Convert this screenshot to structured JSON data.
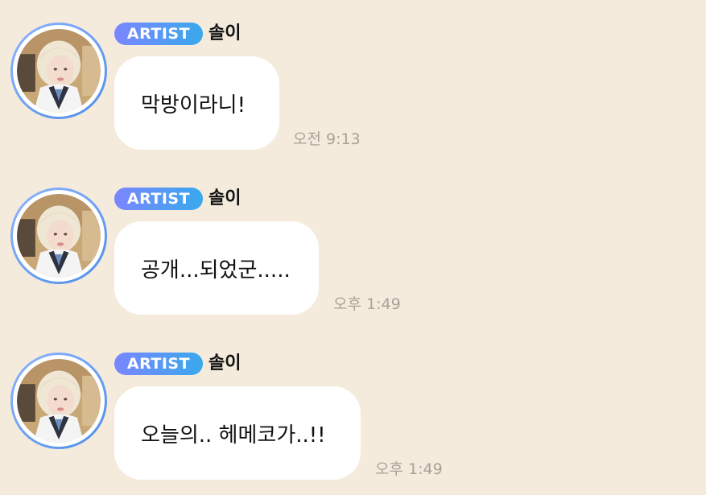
{
  "messages": [
    {
      "badge": "ARTIST",
      "sender": "솔이",
      "text": "막방이라니!",
      "time": "오전 9:13",
      "avatar_icon": "profile-photo"
    },
    {
      "badge": "ARTIST",
      "sender": "솔이",
      "text": "공개...되었군.....",
      "time": "오후 1:49",
      "avatar_icon": "profile-photo"
    },
    {
      "badge": "ARTIST",
      "sender": "솔이",
      "text": "오늘의.. 헤메코가..!!",
      "time": "오후 1:49",
      "avatar_icon": "profile-photo"
    }
  ],
  "colors": {
    "background": "#f4ebdd",
    "bubble": "#ffffff",
    "badge_start": "#7a86ff",
    "badge_end": "#39a9ec",
    "avatar_ring": "#5b95ea",
    "timestamp": "#a9a297"
  }
}
